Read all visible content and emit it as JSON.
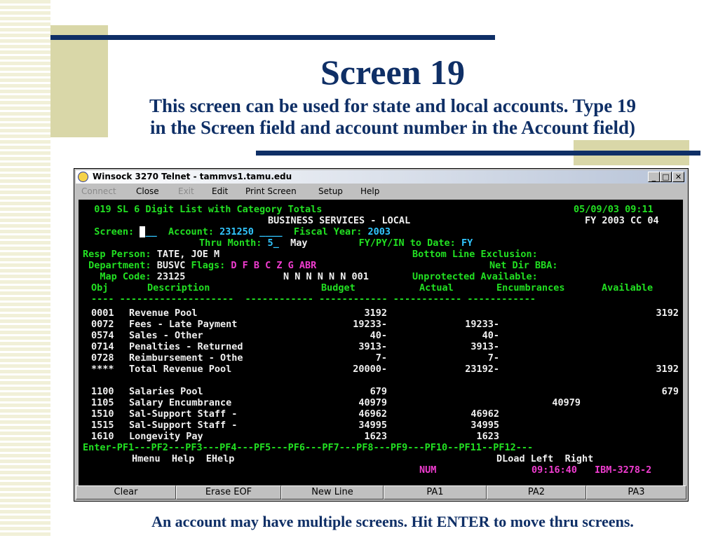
{
  "slide": {
    "title": "Screen 19",
    "subtitle_line1": "This screen can be used for state and local accounts.  Type 19",
    "subtitle_line2": "in the Screen field and account number in the Account field)",
    "caption": "An account may have multiple screens. Hit ENTER to move thru screens."
  },
  "window": {
    "title": "Winsock 3270 Telnet - tammvs1.tamu.edu",
    "app_icon": "winsock-globe-icon",
    "controls": {
      "minimize": "_",
      "maximize": "□",
      "close": "✕"
    },
    "menu": [
      "Connect",
      "Close",
      "Exit",
      "Edit",
      "Print Screen",
      "Setup",
      "Help"
    ],
    "menu_disabled": [
      "Connect",
      "Exit"
    ]
  },
  "terminal": {
    "header": {
      "screen_title": "019 SL 6 Digit List with Category Totals",
      "date_time": "05/09/03 09:11",
      "subtitle": "BUSINESS SERVICES - LOCAL",
      "fy_cc": "FY 2003 CC 04",
      "screen_label": "Screen:",
      "screen_value": "",
      "account_label": "Account:",
      "account_value": "231250",
      "fiscal_label": "Fiscal Year:",
      "fiscal_value": "2003",
      "thru_label": "Thru Month:",
      "thru_value": "5",
      "thru_name": "May",
      "fypy_label": "FY/PY/IN to Date:",
      "fypy_value": "FY",
      "resp_label": "Resp Person:",
      "resp_value": "TATE, JOE M",
      "bottom_label": "Bottom Line Exclusion:",
      "dept_label": "Department:",
      "dept_value": "BUSVC",
      "flags_label": "Flags:",
      "flags_codes": "D F B C Z G ABR",
      "netdir_label": "Net Dir BBA:",
      "map_label": "Map Code:",
      "map_value": "23125",
      "flags_values": "N N N N N N 001",
      "unprot_label": "Unprotected Available:"
    },
    "columns": [
      "Obj",
      "Description",
      "Budget",
      "Actual",
      "Encumbrances",
      "Available"
    ],
    "rows_group1": [
      {
        "obj": "0001",
        "description": "Revenue Pool",
        "budget": "3192",
        "actual": "",
        "encumbrances": "",
        "available": "3192"
      },
      {
        "obj": "0072",
        "description": "Fees - Late Payment",
        "budget": "19233-",
        "actual": "19233-",
        "encumbrances": "",
        "available": ""
      },
      {
        "obj": "0574",
        "description": "Sales - Other",
        "budget": "40-",
        "actual": "40-",
        "encumbrances": "",
        "available": ""
      },
      {
        "obj": "0714",
        "description": "Penalties - Returned",
        "budget": "3913-",
        "actual": "3913-",
        "encumbrances": "",
        "available": ""
      },
      {
        "obj": "0728",
        "description": "Reimbursement - Othe",
        "budget": "7-",
        "actual": "7-",
        "encumbrances": "",
        "available": ""
      },
      {
        "obj": "****",
        "description": "Total Revenue Pool",
        "budget": "20000-",
        "actual": "23192-",
        "encumbrances": "",
        "available": "3192"
      }
    ],
    "rows_group2": [
      {
        "obj": "1100",
        "description": "Salaries Pool",
        "budget": "679",
        "actual": "",
        "encumbrances": "",
        "available": "679"
      },
      {
        "obj": "1105",
        "description": "Salary Encumbrance",
        "budget": "40979",
        "actual": "",
        "encumbrances": "40979",
        "available": ""
      },
      {
        "obj": "1510",
        "description": "Sal-Support Staff -",
        "budget": "46962",
        "actual": "46962",
        "encumbrances": "",
        "available": ""
      },
      {
        "obj": "1515",
        "description": "Sal-Support Staff -",
        "budget": "34995",
        "actual": "34995",
        "encumbrances": "",
        "available": ""
      },
      {
        "obj": "1610",
        "description": "Longevity Pay",
        "budget": "1623",
        "actual": "1623",
        "encumbrances": "",
        "available": ""
      }
    ],
    "pf_keys": [
      "Enter",
      "PF1",
      "PF2",
      "PF3",
      "PF4",
      "PF5",
      "PF6",
      "PF7",
      "PF8",
      "PF9",
      "PF10",
      "PF11",
      "PF12"
    ],
    "pf_labels": {
      "PF1": "Hmenu",
      "PF2": "Help",
      "PF3": "EHelp",
      "PF9": "DLoad",
      "PF10": "Left",
      "PF11": "Right"
    },
    "status": {
      "num": "NUM",
      "time": "09:16:40",
      "terminal": "IBM-3278-2"
    }
  },
  "keybar": [
    "Clear",
    "Erase EOF",
    "New Line",
    "PA1",
    "PA2",
    "PA3"
  ],
  "colors": {
    "navy": "#0f2f66",
    "terminal_green": "#22e022",
    "terminal_cyan": "#31c6ff",
    "terminal_magenta": "#f03cd0"
  }
}
